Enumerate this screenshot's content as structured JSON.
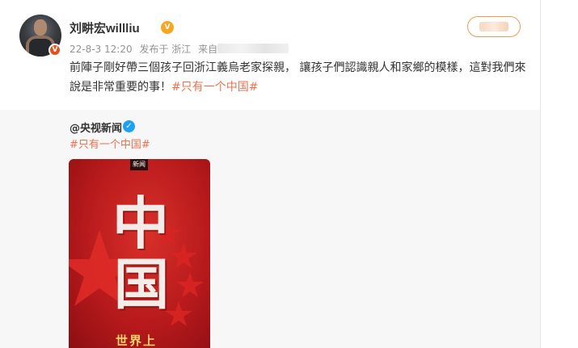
{
  "post": {
    "username": "刘畊宏willliu",
    "vip_icon_text": "V",
    "verified_badge_text": "V",
    "date": "22-8-3 12:20",
    "source": "发布于 浙江",
    "from_label": "来自",
    "text_part1": "前陣子剛好帶三個孩子回浙江義烏老家探親， 讓孩子們認識親人和家鄉的模樣，這對我們來說是非常重要的事！",
    "hashtag": "#只有一个中国#"
  },
  "repost": {
    "author": "@央视新闻",
    "verified_text": "✓",
    "hashtag": "#只有一个中国#",
    "poster": {
      "badge": "新闻",
      "char1": "中",
      "char2": "国",
      "caption": "世界上"
    }
  },
  "colors": {
    "accent": "#eb7350",
    "follow_border": "#f29a4c",
    "verified_blue": "#1da1f2",
    "poster_red": "#c41e20"
  }
}
